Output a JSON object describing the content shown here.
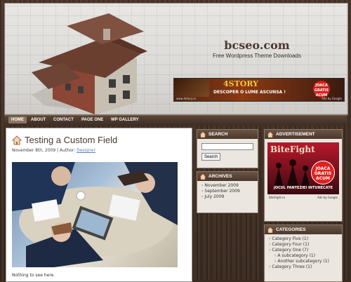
{
  "site": {
    "title": "bcseo.com",
    "tagline": "Free Wordpress Theme Downloads"
  },
  "banner_ad": {
    "title": "4STORY",
    "subtitle": "DESCOPER O LUME ASCUNSA !",
    "badge": "JOACA GRATIS ACUM",
    "url": "www.4story.ro",
    "ads_label": "Ads by Google"
  },
  "nav": {
    "items": [
      {
        "label": "HOME",
        "active": true
      },
      {
        "label": "ABOUT"
      },
      {
        "label": "CONTACT"
      },
      {
        "label": "PAGE ONE"
      },
      {
        "label": "WP GALLERY"
      }
    ]
  },
  "post": {
    "title": "Testing a Custom Field",
    "date": "November 8th, 2009",
    "author_prefix": "| Author:",
    "author": "Designer",
    "body": "Nothing to see here."
  },
  "search_widget": {
    "heading": "SEARCH",
    "button": "Search",
    "value": ""
  },
  "archives_widget": {
    "heading": "ARCHIVES",
    "items": [
      "November 2009",
      "September 2009",
      "July 2009"
    ]
  },
  "advert_widget": {
    "heading": "ADVERTISEMENT",
    "ad_title": "BiteFight",
    "ad_badge": "JOACA GRATIS ACUM",
    "ad_sub": "JOCUL FANTEZIEI INTUNECATE",
    "ad_url": "BiteFight.ro",
    "ads_label": "Ads by Google"
  },
  "categories_widget": {
    "heading": "CATEGORIES",
    "items": [
      {
        "label": "Category Five (1)",
        "sub": false
      },
      {
        "label": "Category Four (1)",
        "sub": false
      },
      {
        "label": "Category One (7)",
        "sub": false
      },
      {
        "label": "A subcategory (1)",
        "sub": true
      },
      {
        "label": "Another subcategory (1)",
        "sub": true
      },
      {
        "label": "Category Three (1)",
        "sub": false
      }
    ]
  },
  "colors": {
    "accent": "#4a3a30",
    "link": "#5b7fb3",
    "nav_bg": "#3d2d24"
  }
}
